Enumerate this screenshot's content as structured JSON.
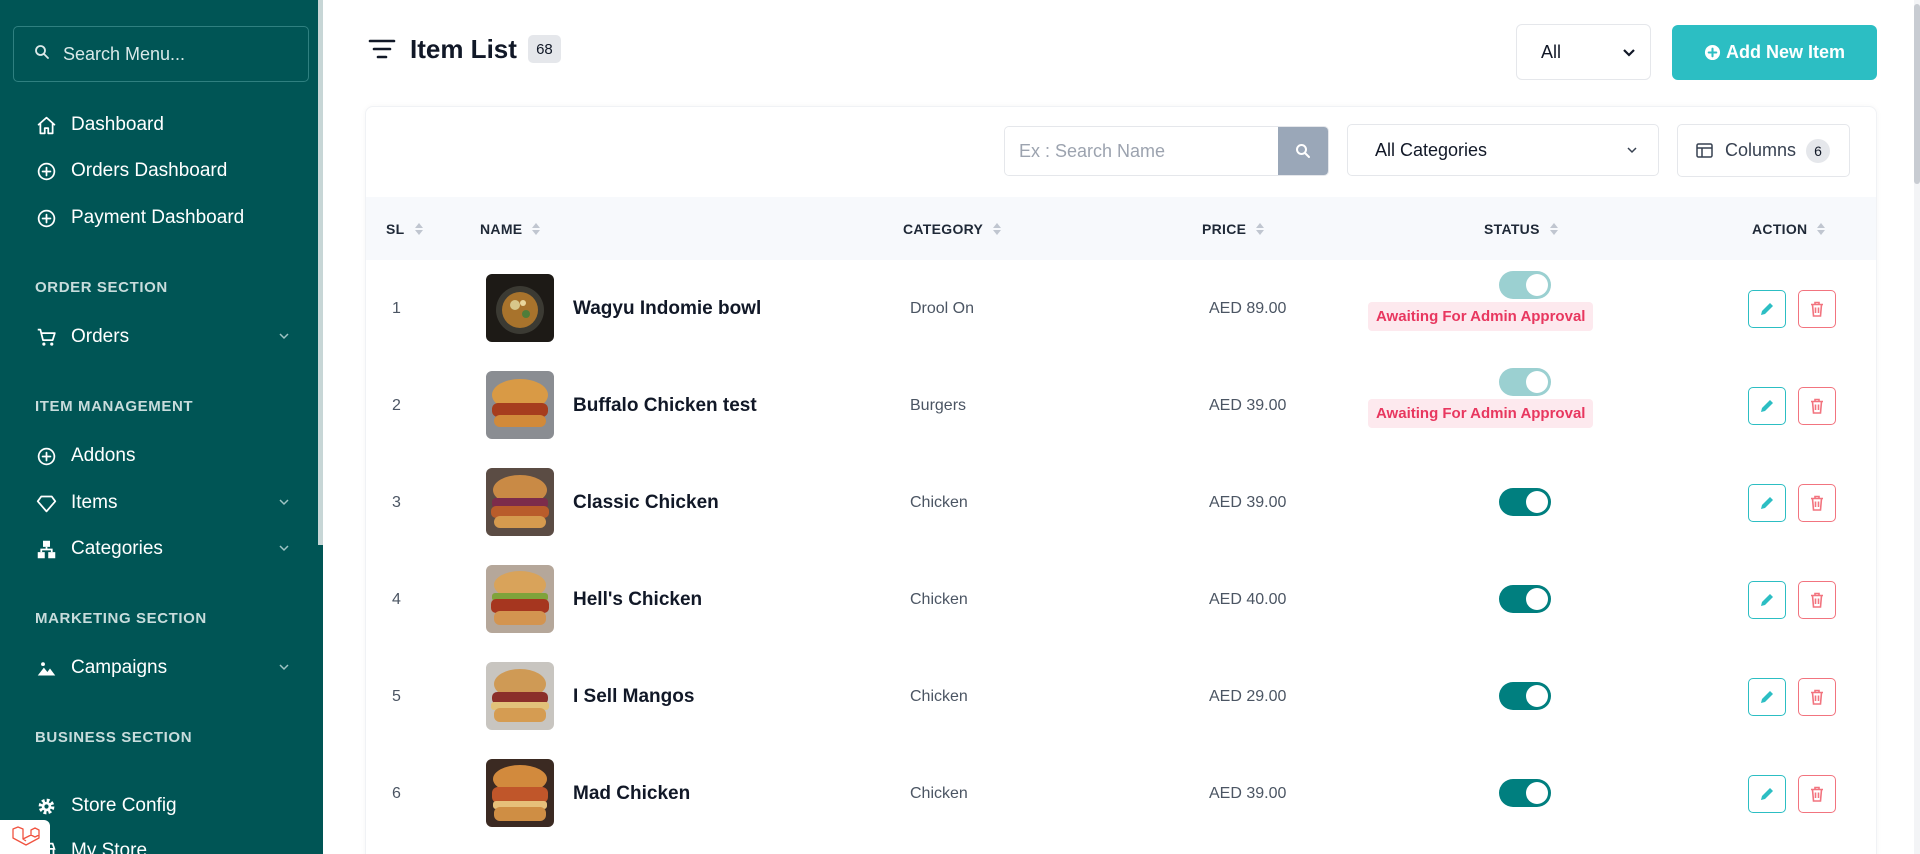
{
  "sidebar": {
    "search_placeholder": "Search Menu...",
    "items": [
      {
        "label": "Dashboard",
        "icon": "home-icon"
      },
      {
        "label": "Orders Dashboard",
        "icon": "plus-circle-icon"
      },
      {
        "label": "Payment Dashboard",
        "icon": "plus-circle-icon"
      },
      {
        "label": "Orders",
        "icon": "cart-icon"
      },
      {
        "label": "Addons",
        "icon": "plus-circle-icon"
      },
      {
        "label": "Items",
        "icon": "diamond-icon"
      },
      {
        "label": "Categories",
        "icon": "hierarchy-icon"
      },
      {
        "label": "Campaigns",
        "icon": "image-icon"
      },
      {
        "label": "Store Config",
        "icon": "gear-icon"
      },
      {
        "label": "My Store",
        "icon": "store-icon"
      }
    ],
    "sections": [
      "ORDER SECTION",
      "ITEM MANAGEMENT",
      "MARKETING SECTION",
      "BUSINESS SECTION"
    ]
  },
  "header": {
    "title": "Item List",
    "count": "68",
    "status_filter": "All",
    "add_button": "Add New Item"
  },
  "toolbar": {
    "search_placeholder": "Ex : Search Name",
    "category_filter": "All Categories",
    "columns_label": "Columns",
    "columns_count": "6"
  },
  "table": {
    "headers": [
      "SL",
      "NAME",
      "CATEGORY",
      "PRICE",
      "STATUS",
      "ACTION"
    ],
    "rows": [
      {
        "sl": "1",
        "name": "Wagyu Indomie bowl",
        "category": "Drool On",
        "price": "AED 89.00",
        "status": "pending",
        "badge": "Awaiting For Admin Approval"
      },
      {
        "sl": "2",
        "name": "Buffalo Chicken test",
        "category": "Burgers",
        "price": "AED 39.00",
        "status": "pending",
        "badge": "Awaiting For Admin Approval"
      },
      {
        "sl": "3",
        "name": "Classic Chicken",
        "category": "Chicken",
        "price": "AED 39.00",
        "status": "on",
        "badge": ""
      },
      {
        "sl": "4",
        "name": "Hell's Chicken",
        "category": "Chicken",
        "price": "AED 40.00",
        "status": "on",
        "badge": ""
      },
      {
        "sl": "5",
        "name": "I Sell Mangos",
        "category": "Chicken",
        "price": "AED 29.00",
        "status": "on",
        "badge": ""
      },
      {
        "sl": "6",
        "name": "Mad Chicken",
        "category": "Chicken",
        "price": "AED 39.00",
        "status": "on",
        "badge": ""
      }
    ]
  },
  "colors": {
    "sidebar_bg": "#005555",
    "accent": "#2cbec3",
    "toggle_on": "#007f7f",
    "danger": "#f2747f"
  }
}
